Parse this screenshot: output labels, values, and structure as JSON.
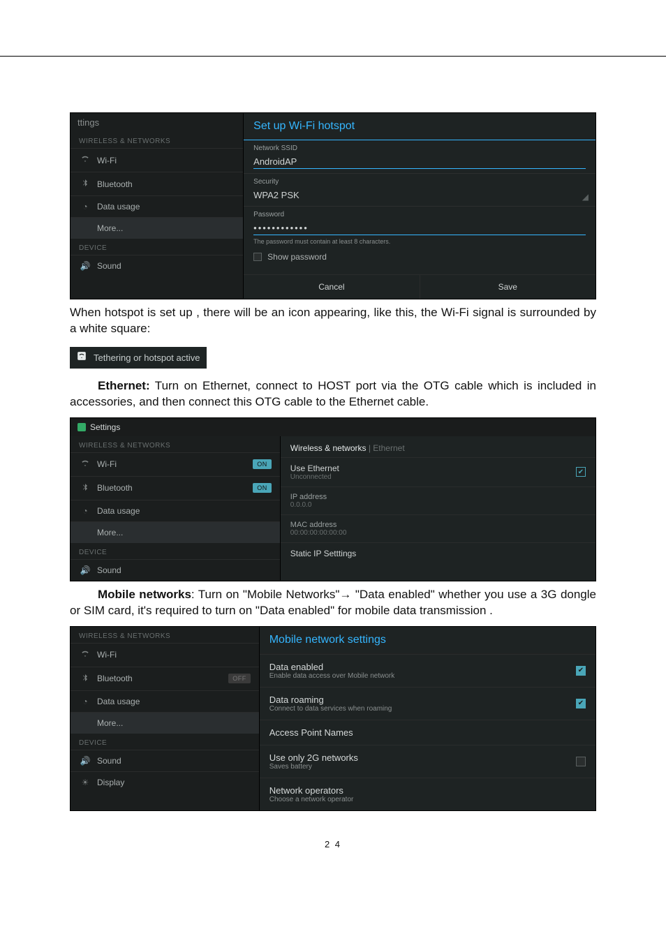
{
  "hotspot": {
    "sidebar_header": "ttings",
    "section_wireless": "WIRELESS & NETWORKS",
    "items": {
      "wifi": "Wi-Fi",
      "bluetooth": "Bluetooth",
      "data_usage": "Data usage",
      "more": "More...",
      "sound": "Sound"
    },
    "section_device": "DEVICE",
    "dialog": {
      "title": "Set up Wi-Fi hotspot",
      "ssid_label": "Network SSID",
      "ssid_value": "AndroidAP",
      "security_label": "Security",
      "security_value": "WPA2 PSK",
      "password_label": "Password",
      "password_value": "••••••••••••",
      "hint": "The password must contain at least 8 characters.",
      "show_password": "Show password",
      "cancel": "Cancel",
      "save": "Save"
    }
  },
  "para1": "When hotspot is set up , there will be an icon appearing, like this, the Wi-Fi signal is surrounded by a white square:",
  "tethering_active": "Tethering or hotspot active",
  "para2_strong": "Ethernet:",
  "para2": " Turn on Ethernet, connect to HOST port via the OTG cable which is included in accessories, and then connect this OTG cable to the Ethernet cable.",
  "ethernet": {
    "appbar": "Settings",
    "section_wireless": "WIRELESS & NETWORKS",
    "items": {
      "wifi": "Wi-Fi",
      "bluetooth": "Bluetooth",
      "data_usage": "Data usage",
      "more": "More...",
      "sound": "Sound"
    },
    "section_device": "DEVICE",
    "toggle_on": "ON",
    "crumb_main": "Wireless & networks",
    "crumb_sub": "Ethernet",
    "use_ethernet": "Use Ethernet",
    "unconnected": "Unconnected",
    "ip_label": "IP address",
    "ip_value": "0.0.0.0",
    "mac_label": "MAC address",
    "mac_value": "00:00:00:00:00:00",
    "static_ip": "Static IP Setttings"
  },
  "para3_strong": "Mobile networks",
  "para3": ": Turn on \"Mobile Networks\"→ \"Data enabled\" whether you use a 3G dongle or SIM card, it's required to turn on \"Data enabled\" for mobile data transmission .",
  "mobile": {
    "section_wireless": "WIRELESS & NETWORKS",
    "items": {
      "wifi": "Wi-Fi",
      "bluetooth": "Bluetooth",
      "data_usage": "Data usage",
      "more": "More...",
      "sound": "Sound",
      "display": "Display"
    },
    "section_device": "DEVICE",
    "toggle_off": "OFF",
    "title": "Mobile network settings",
    "rows": {
      "data_enabled": "Data enabled",
      "data_enabled_sub": "Enable data access over Mobile network",
      "data_roaming": "Data roaming",
      "data_roaming_sub": "Connect to data services when roaming",
      "apn": "Access Point Names",
      "use2g": "Use only 2G networks",
      "use2g_sub": "Saves battery",
      "netop": "Network operators",
      "netop_sub": "Choose a network operator"
    }
  },
  "page_num": "2 4"
}
